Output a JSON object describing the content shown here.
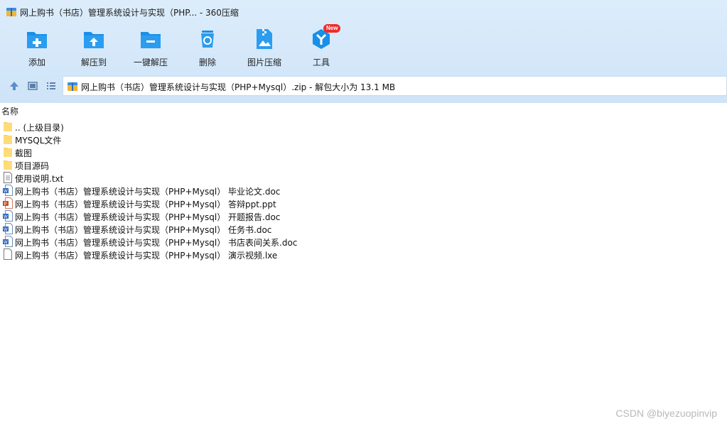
{
  "window": {
    "title": "网上购书（书店）管理系统设计与实现（PHP... - 360压缩",
    "app_icon": "360zip-app-icon"
  },
  "toolbar": {
    "items": [
      {
        "label": "添加",
        "icon": "folder-add-icon"
      },
      {
        "label": "解压到",
        "icon": "folder-extract-icon"
      },
      {
        "label": "一键解压",
        "icon": "folder-oneclick-extract-icon"
      },
      {
        "label": "删除",
        "icon": "trash-recycle-icon"
      },
      {
        "label": "图片压缩",
        "icon": "image-compress-icon"
      },
      {
        "label": "工具",
        "icon": "tools-cube-icon",
        "badge": "New"
      }
    ]
  },
  "nav": {
    "buttons": [
      "up-arrow-icon",
      "thumbnail-view-icon",
      "list-view-icon"
    ],
    "address": "网上购书（书店）管理系统设计与实现（PHP+Mysql）.zip - 解包大小为 13.1 MB"
  },
  "list": {
    "column_name": "名称",
    "items": [
      {
        "name": ".. (上级目录)",
        "type": "folder"
      },
      {
        "name": "MYSQL文件",
        "type": "folder"
      },
      {
        "name": "截图",
        "type": "folder"
      },
      {
        "name": "项目源码",
        "type": "folder"
      },
      {
        "name": "使用说明.txt",
        "type": "txt"
      },
      {
        "name": "网上购书（书店）管理系统设计与实现（PHP+Mysql） 毕业论文.doc",
        "type": "doc"
      },
      {
        "name": "网上购书（书店）管理系统设计与实现（PHP+Mysql） 答辩ppt.ppt",
        "type": "ppt"
      },
      {
        "name": "网上购书（书店）管理系统设计与实现（PHP+Mysql） 开题报告.doc",
        "type": "doc"
      },
      {
        "name": "网上购书（书店）管理系统设计与实现（PHP+Mysql） 任务书.doc",
        "type": "doc"
      },
      {
        "name": "网上购书（书店）管理系统设计与实现（PHP+Mysql） 书店表间关系.doc",
        "type": "doc"
      },
      {
        "name": "网上购书（书店）管理系统设计与实现（PHP+Mysql） 演示视频.lxe",
        "type": "file"
      }
    ]
  },
  "watermark": "CSDN @biyezuopinvip",
  "colors": {
    "toolbar_bg": "#d3e7fa",
    "icon_blue": "#1a8fe8",
    "badge_red": "#ef2b2b",
    "folder_yellow": "#ffd25e"
  }
}
